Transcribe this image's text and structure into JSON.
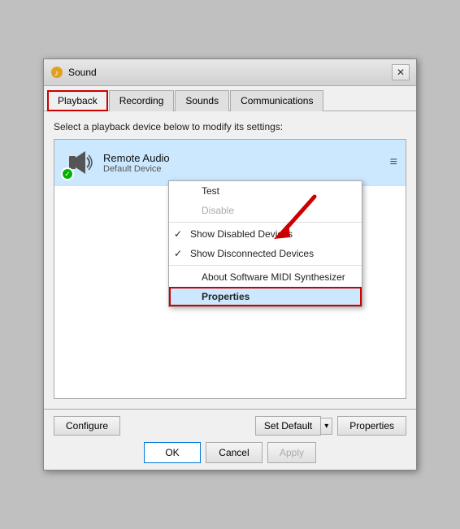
{
  "dialog": {
    "title": "Sound",
    "close_label": "✕"
  },
  "tabs": [
    {
      "id": "playback",
      "label": "Playback",
      "active": true
    },
    {
      "id": "recording",
      "label": "Recording",
      "active": false
    },
    {
      "id": "sounds",
      "label": "Sounds",
      "active": false
    },
    {
      "id": "communications",
      "label": "Communications",
      "active": false
    }
  ],
  "description": "Select a playback device below to modify its settings:",
  "device": {
    "name": "Remote Audio",
    "status": "Default Device"
  },
  "context_menu": {
    "items": [
      {
        "id": "test",
        "label": "Test",
        "check": false,
        "disabled": false
      },
      {
        "id": "disable",
        "label": "Disable",
        "check": false,
        "disabled": true
      },
      {
        "id": "sep1",
        "separator": true
      },
      {
        "id": "show-disabled",
        "label": "Show Disabled Devices",
        "check": true,
        "disabled": false
      },
      {
        "id": "show-disconnected",
        "label": "Show Disconnected Devices",
        "check": true,
        "disabled": false
      },
      {
        "id": "sep2",
        "separator": true
      },
      {
        "id": "about-midi",
        "label": "About Software MIDI Synthesizer",
        "check": false,
        "disabled": false
      },
      {
        "id": "properties",
        "label": "Properties",
        "check": false,
        "disabled": false,
        "highlighted": true
      }
    ]
  },
  "buttons": {
    "configure": "Configure",
    "set_default": "Set Default",
    "properties": "Properties",
    "ok": "OK",
    "cancel": "Cancel",
    "apply": "Apply"
  }
}
